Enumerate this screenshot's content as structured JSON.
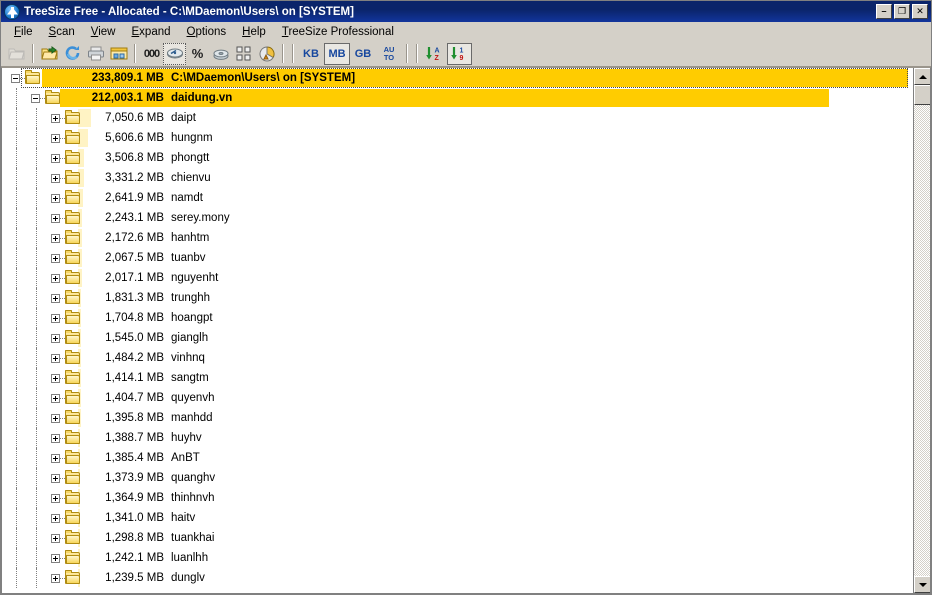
{
  "window": {
    "title": "TreeSize Free - Allocated - C:\\MDaemon\\Users\\ on [SYSTEM]",
    "icon": "treesize-app-icon",
    "minimize_label": "–",
    "maximize_label": "❐",
    "close_label": "✕"
  },
  "menubar": {
    "items": [
      {
        "label": "File",
        "accel": "F"
      },
      {
        "label": "Scan",
        "accel": "S"
      },
      {
        "label": "View",
        "accel": "V"
      },
      {
        "label": "Expand",
        "accel": "E"
      },
      {
        "label": "Options",
        "accel": "O"
      },
      {
        "label": "Help",
        "accel": "H"
      },
      {
        "label": "TreeSize Professional",
        "accel": "T"
      }
    ]
  },
  "toolbar": {
    "buttons": [
      {
        "name": "open-disabled-icon",
        "kind": "icon",
        "glyph": "folder-open-gray",
        "state": "disabled"
      },
      {
        "name": "open-folder-icon",
        "kind": "icon",
        "glyph": "folder-open-arrow",
        "state": "normal"
      },
      {
        "name": "refresh-icon",
        "kind": "icon",
        "glyph": "refresh-circular-arrows",
        "state": "normal"
      },
      {
        "name": "print-icon",
        "kind": "icon",
        "glyph": "printer",
        "state": "normal"
      },
      {
        "name": "explorer-icon",
        "kind": "icon",
        "glyph": "folder-window",
        "state": "normal"
      },
      {
        "name": "show-numbers-icon",
        "kind": "text",
        "label": "000",
        "state": "normal"
      },
      {
        "name": "show-bars-icon",
        "kind": "icon",
        "glyph": "bar-gauge",
        "state": "pressed"
      },
      {
        "name": "show-percent-icon",
        "kind": "text",
        "label": "%",
        "state": "normal"
      },
      {
        "name": "disk-usage-icon",
        "kind": "icon",
        "glyph": "disk",
        "state": "normal"
      },
      {
        "name": "details-view-icon",
        "kind": "icon",
        "glyph": "grid-squares",
        "state": "normal"
      },
      {
        "name": "chart-icon",
        "kind": "icon",
        "glyph": "pie-chart",
        "state": "normal"
      },
      {
        "name": "unit-kb-button",
        "kind": "text",
        "label": "KB",
        "state": "normal"
      },
      {
        "name": "unit-mb-button",
        "kind": "text",
        "label": "MB",
        "state": "selected"
      },
      {
        "name": "unit-gb-button",
        "kind": "text",
        "label": "GB",
        "state": "normal"
      },
      {
        "name": "unit-auto-button",
        "kind": "auto",
        "label_top": "AU",
        "label_bottom": "TO",
        "state": "normal"
      },
      {
        "name": "sort-alpha-button",
        "kind": "sort",
        "label_top": "A",
        "label_bottom": "Z",
        "state": "normal"
      },
      {
        "name": "sort-numeric-button",
        "kind": "sort",
        "label_top": "1",
        "label_bottom": "9",
        "state": "selected"
      }
    ],
    "accent_color": "#17479e"
  },
  "tree": {
    "unit": "MB",
    "bar_color_major": "#ffcc00",
    "bar_color_minor": "#fff3c4",
    "rows": [
      {
        "level": 1,
        "expanded": true,
        "size": "233,809.1 MB",
        "name": "C:\\MDaemon\\Users\\ on [SYSTEM]",
        "value": 233809.1,
        "focused": true
      },
      {
        "level": 2,
        "expanded": true,
        "size": "212,003.1 MB",
        "name": "daidung.vn",
        "value": 212003.1
      },
      {
        "level": 3,
        "expanded": false,
        "size": "7,050.6 MB",
        "name": "daipt",
        "value": 7050.6
      },
      {
        "level": 3,
        "expanded": false,
        "size": "5,606.6 MB",
        "name": "hungnm",
        "value": 5606.6
      },
      {
        "level": 3,
        "expanded": false,
        "size": "3,506.8 MB",
        "name": "phongtt",
        "value": 3506.8
      },
      {
        "level": 3,
        "expanded": false,
        "size": "3,331.2 MB",
        "name": "chienvu",
        "value": 3331.2
      },
      {
        "level": 3,
        "expanded": false,
        "size": "2,641.9 MB",
        "name": "namdt",
        "value": 2641.9
      },
      {
        "level": 3,
        "expanded": false,
        "size": "2,243.1 MB",
        "name": "serey.mony",
        "value": 2243.1
      },
      {
        "level": 3,
        "expanded": false,
        "size": "2,172.6 MB",
        "name": "hanhtm",
        "value": 2172.6
      },
      {
        "level": 3,
        "expanded": false,
        "size": "2,067.5 MB",
        "name": "tuanbv",
        "value": 2067.5
      },
      {
        "level": 3,
        "expanded": false,
        "size": "2,017.1 MB",
        "name": "nguyenht",
        "value": 2017.1
      },
      {
        "level": 3,
        "expanded": false,
        "size": "1,831.3 MB",
        "name": "trunghh",
        "value": 1831.3
      },
      {
        "level": 3,
        "expanded": false,
        "size": "1,704.8 MB",
        "name": "hoangpt",
        "value": 1704.8
      },
      {
        "level": 3,
        "expanded": false,
        "size": "1,545.0 MB",
        "name": "gianglh",
        "value": 1545.0
      },
      {
        "level": 3,
        "expanded": false,
        "size": "1,484.2 MB",
        "name": "vinhnq",
        "value": 1484.2
      },
      {
        "level": 3,
        "expanded": false,
        "size": "1,414.1 MB",
        "name": "sangtm",
        "value": 1414.1
      },
      {
        "level": 3,
        "expanded": false,
        "size": "1,404.7 MB",
        "name": "quyenvh",
        "value": 1404.7
      },
      {
        "level": 3,
        "expanded": false,
        "size": "1,395.8 MB",
        "name": "manhdd",
        "value": 1395.8
      },
      {
        "level": 3,
        "expanded": false,
        "size": "1,388.7 MB",
        "name": "huyhv",
        "value": 1388.7
      },
      {
        "level": 3,
        "expanded": false,
        "size": "1,385.4 MB",
        "name": "AnBT",
        "value": 1385.4
      },
      {
        "level": 3,
        "expanded": false,
        "size": "1,373.9 MB",
        "name": "quanghv",
        "value": 1373.9
      },
      {
        "level": 3,
        "expanded": false,
        "size": "1,364.9 MB",
        "name": "thinhnvh",
        "value": 1364.9
      },
      {
        "level": 3,
        "expanded": false,
        "size": "1,341.0 MB",
        "name": "haitv",
        "value": 1341.0
      },
      {
        "level": 3,
        "expanded": false,
        "size": "1,298.8 MB",
        "name": "tuankhai",
        "value": 1298.8
      },
      {
        "level": 3,
        "expanded": false,
        "size": "1,242.1 MB",
        "name": "luanlhh",
        "value": 1242.1
      },
      {
        "level": 3,
        "expanded": false,
        "size": "1,239.5 MB",
        "name": "dunglv",
        "value": 1239.5
      }
    ]
  },
  "scrollbar": {
    "up_arrow": "scroll-up",
    "down_arrow": "scroll-down",
    "thumb": "scroll-thumb"
  }
}
